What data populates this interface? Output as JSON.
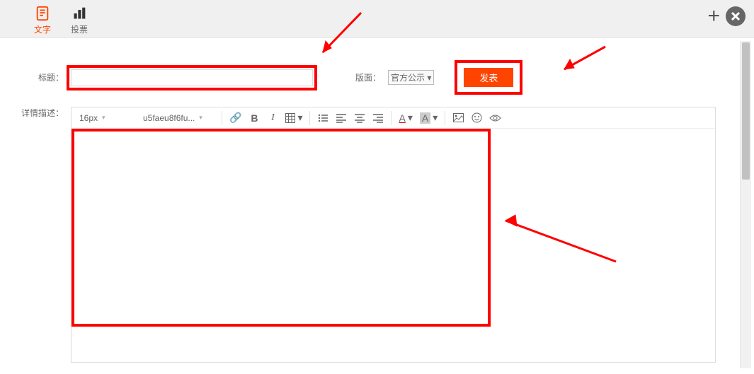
{
  "tabs": {
    "text": "文字",
    "vote": "投票"
  },
  "form": {
    "titleLabel": "标题：",
    "sectionLabel": "版面：",
    "sectionValue": "官方公示 ▾",
    "publish": "发表",
    "descLabel": "详情描述："
  },
  "toolbar": {
    "fontsize": "16px",
    "fontname": "u5faeu8f6fu..."
  }
}
